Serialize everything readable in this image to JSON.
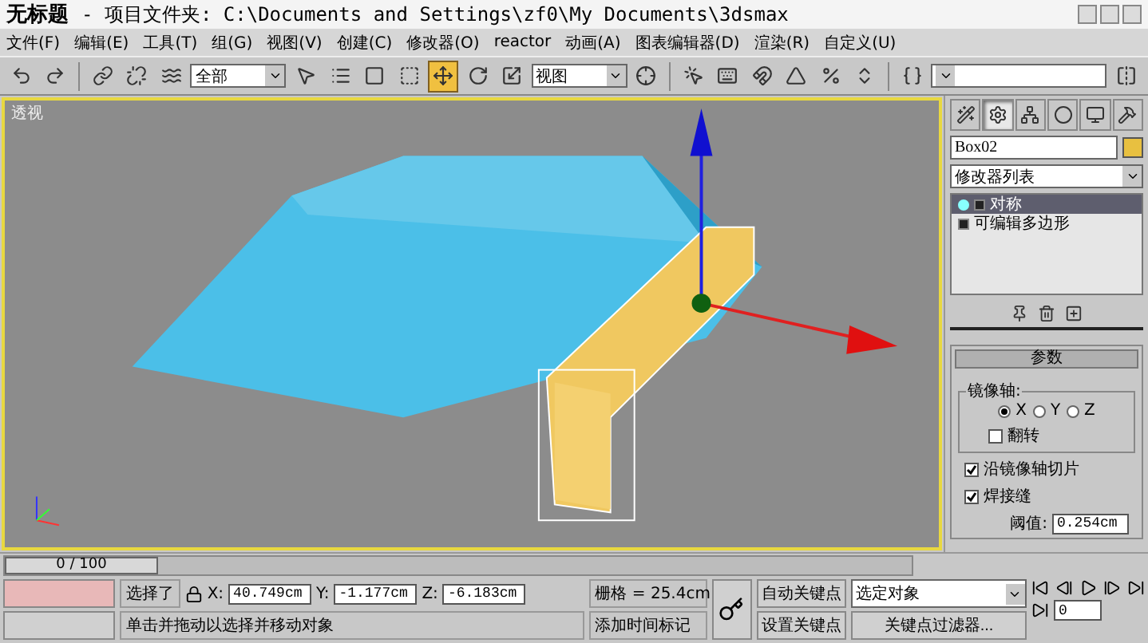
{
  "window": {
    "title": "无标题",
    "subtitle": "- 项目文件夹: C:\\Documents and Settings\\zf0\\My Documents\\3dsmax"
  },
  "menu": [
    "文件(F)",
    "编辑(E)",
    "工具(T)",
    "组(G)",
    "视图(V)",
    "创建(C)",
    "修改器(O)",
    "reactor",
    "动画(A)",
    "图表编辑器(D)",
    "渲染(R)",
    "自定义(U)"
  ],
  "toolbar": [
    {
      "kind": "undo",
      "selected": false
    },
    {
      "kind": "redo",
      "selected": false
    },
    {
      "kind": "sep"
    },
    {
      "kind": "link",
      "selected": false
    },
    {
      "kind": "unlink",
      "selected": false
    },
    {
      "kind": "bind",
      "selected": false
    },
    {
      "kind": "dropdown",
      "value": "全部"
    },
    {
      "kind": "select",
      "selected": false
    },
    {
      "kind": "list",
      "selected": false
    },
    {
      "kind": "region",
      "selected": false
    },
    {
      "kind": "crossing",
      "selected": false
    },
    {
      "kind": "move",
      "selected": true
    },
    {
      "kind": "rotate",
      "selected": false
    },
    {
      "kind": "scale",
      "selected": false
    },
    {
      "kind": "dropdown",
      "value": "视图"
    },
    {
      "kind": "pivot",
      "selected": false
    },
    {
      "kind": "sep"
    },
    {
      "kind": "manipulate",
      "selected": false
    },
    {
      "kind": "keyboard",
      "selected": false
    },
    {
      "kind": "snap",
      "selected": false
    },
    {
      "kind": "angle",
      "selected": false
    },
    {
      "kind": "percent",
      "selected": false
    },
    {
      "kind": "spinner",
      "selected": false
    },
    {
      "kind": "sep"
    },
    {
      "kind": "sets",
      "selected": false
    },
    {
      "kind": "dropdown"
    },
    {
      "kind": "mirror",
      "selected": false
    }
  ],
  "viewport": {
    "label": "透视"
  },
  "command_panel": {
    "tabs": [
      {
        "kind": "create",
        "selected": false
      },
      {
        "kind": "modify",
        "selected": true
      },
      {
        "kind": "hierarchy",
        "selected": false
      },
      {
        "kind": "motion",
        "selected": false
      },
      {
        "kind": "display",
        "selected": false
      },
      {
        "kind": "utilities",
        "selected": false
      }
    ],
    "object_name": "Box02",
    "modifier_list": "修改器列表",
    "stack": [
      {
        "label": "对称",
        "selected": true,
        "expandable": true
      },
      {
        "label": "可编辑多边形",
        "selected": false,
        "expandable": false
      }
    ],
    "rollout": {
      "title": "参数",
      "group": "镜像轴:",
      "axes": [
        {
          "label": "X",
          "selected": true
        },
        {
          "label": "Y",
          "selected": false
        },
        {
          "label": "Z",
          "selected": false
        }
      ],
      "flip": {
        "label": "翻转",
        "checked": false
      },
      "options": [
        {
          "label": "沿镜像轴切片",
          "checked": true
        },
        {
          "label": "焊接缝",
          "checked": true
        }
      ],
      "threshold_label": "阈值:",
      "threshold": "0.254cm"
    }
  },
  "time_slider": {
    "label": "0 / 100",
    "level": 0
  },
  "status_bar": {
    "selection": "选择了",
    "x_label": "X:",
    "x": "40.749cm",
    "y_label": "Y:",
    "y": "-1.177cm",
    "z_label": "Z:",
    "z": "-6.183cm",
    "grid": "栅格 = 25.4cm",
    "prompt": "单击并拖动以选择并移动对象",
    "add_tag": "添加时间标记",
    "auto_key": {
      "label": "自动关键点",
      "on": false
    },
    "set_key": "设置关键点",
    "key_filter_select": "选定对象",
    "key_filters": "关键点过滤器...",
    "frame": "0"
  }
}
